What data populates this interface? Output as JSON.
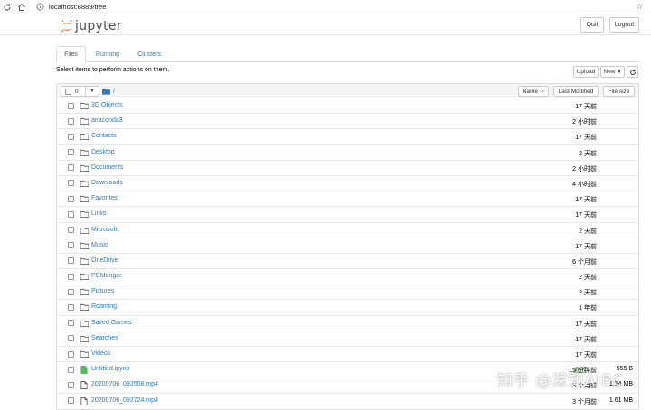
{
  "browser": {
    "url": "localhost:8889/tree"
  },
  "header": {
    "logo_text": "jupyter",
    "quit_label": "Quit",
    "logout_label": "Logout"
  },
  "tabs": [
    {
      "label": "Files"
    },
    {
      "label": "Running"
    },
    {
      "label": "Clusters"
    }
  ],
  "toolbar": {
    "instructions": "Select items to perform actions on them.",
    "upload_label": "Upload",
    "new_label": "New",
    "refresh_icon": "refresh-icon"
  },
  "list_header": {
    "selected_count": "0",
    "path": "/",
    "name_label": "Name",
    "last_modified_label": "Last Modified",
    "file_size_label": "File size"
  },
  "items": [
    {
      "type": "folder",
      "name": "3D Objects",
      "modified": "17 天前",
      "size": ""
    },
    {
      "type": "folder",
      "name": "anaconda3",
      "modified": "2 小时前",
      "size": ""
    },
    {
      "type": "folder",
      "name": "Contacts",
      "modified": "17 天前",
      "size": ""
    },
    {
      "type": "folder",
      "name": "Desktop",
      "modified": "2 天前",
      "size": ""
    },
    {
      "type": "folder",
      "name": "Documents",
      "modified": "2 小时前",
      "size": ""
    },
    {
      "type": "folder",
      "name": "Downloads",
      "modified": "4 小时前",
      "size": ""
    },
    {
      "type": "folder",
      "name": "Favorites",
      "modified": "17 天前",
      "size": ""
    },
    {
      "type": "folder",
      "name": "Links",
      "modified": "17 天前",
      "size": ""
    },
    {
      "type": "folder",
      "name": "Microsoft",
      "modified": "2 天前",
      "size": ""
    },
    {
      "type": "folder",
      "name": "Music",
      "modified": "17 天前",
      "size": ""
    },
    {
      "type": "folder",
      "name": "OneDrive",
      "modified": "6 个月前",
      "size": ""
    },
    {
      "type": "folder",
      "name": "PCManger",
      "modified": "2 天前",
      "size": ""
    },
    {
      "type": "folder",
      "name": "Pictures",
      "modified": "2 天前",
      "size": ""
    },
    {
      "type": "folder",
      "name": "Roaming",
      "modified": "1 年前",
      "size": ""
    },
    {
      "type": "folder",
      "name": "Saved Games",
      "modified": "17 天前",
      "size": ""
    },
    {
      "type": "folder",
      "name": "Searches",
      "modified": "17 天前",
      "size": ""
    },
    {
      "type": "folder",
      "name": "Videos",
      "modified": "17 天前",
      "size": ""
    },
    {
      "type": "notebook",
      "name": "Untitled.ipynb",
      "running": "运行",
      "modified": "15 分钟前",
      "size": "555 B"
    },
    {
      "type": "file",
      "name": "20200706_092558.mp4",
      "modified": "3 个月前",
      "size": "1.54 MB"
    },
    {
      "type": "file",
      "name": "20200706_092724.mp4",
      "modified": "3 个月前",
      "size": "1.61 MB"
    }
  ],
  "watermark": "知乎 @深知AIBC",
  "colors": {
    "link": "#337ab7",
    "logo_orange": "#f37726",
    "running_green": "#3c763d"
  }
}
